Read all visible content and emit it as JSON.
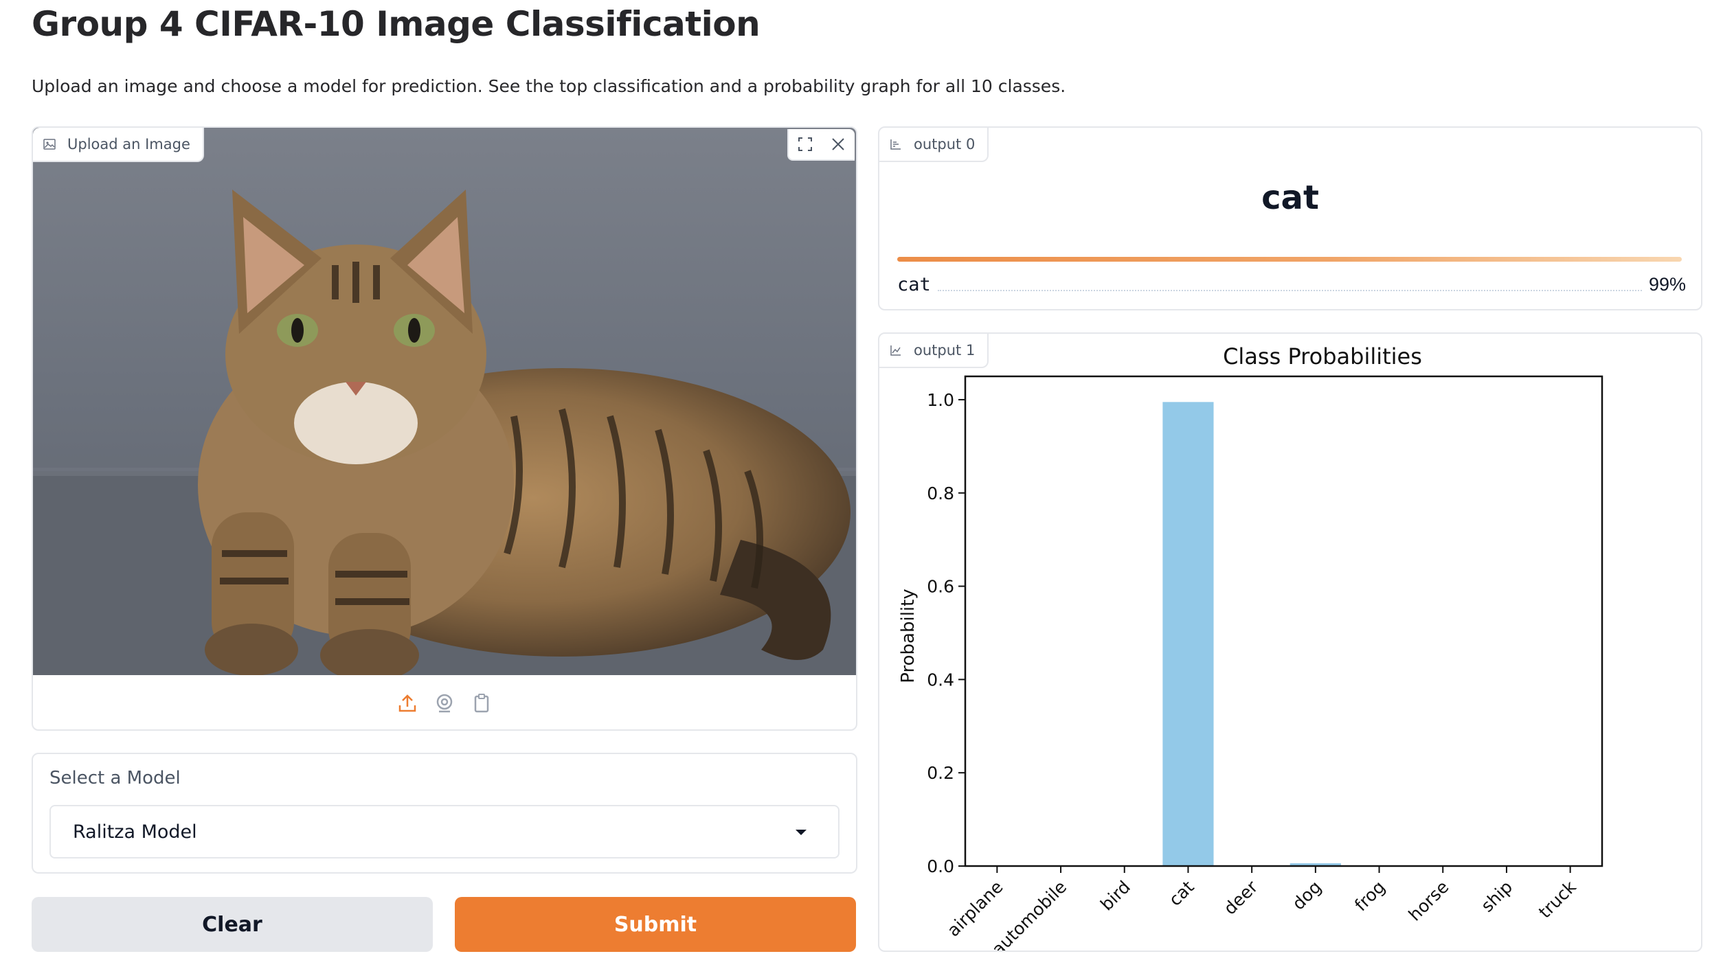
{
  "page": {
    "title": "Group 4 CIFAR-10 Image Classification",
    "description": "Upload an image and choose a model for prediction. See the top classification and a probability graph for all 10 classes."
  },
  "image_input": {
    "label": "Upload an Image"
  },
  "model_select": {
    "label": "Select a Model",
    "value": "Ralitza Model"
  },
  "buttons": {
    "clear": "Clear",
    "submit": "Submit"
  },
  "output0": {
    "label": "output 0",
    "top_class": "cat",
    "confidences": [
      {
        "label": "cat",
        "value": 0.99,
        "display": "99%"
      }
    ]
  },
  "output1": {
    "label": "output 1"
  },
  "colors": {
    "accent": "#ed7d31",
    "bar": "#93c9e8",
    "secondary_button": "#e5e7eb"
  },
  "icons": {
    "upload_label": "image-icon",
    "tools": [
      "fullscreen-icon",
      "close-icon"
    ],
    "sources": [
      "upload-icon",
      "webcam-icon",
      "clipboard-icon"
    ],
    "output0": "label-icon",
    "output1": "chart-icon"
  },
  "chart_data": {
    "type": "bar",
    "title": "Class Probabilities",
    "xlabel": "",
    "ylabel": "Probability",
    "categories": [
      "airplane",
      "automobile",
      "bird",
      "cat",
      "deer",
      "dog",
      "frog",
      "horse",
      "ship",
      "truck"
    ],
    "values": [
      0.0,
      0.0,
      0.0,
      0.995,
      0.0,
      0.006,
      0.0,
      0.0,
      0.0,
      0.0
    ],
    "yticks": [
      "0.0",
      "0.2",
      "0.4",
      "0.6",
      "0.8",
      "1.0"
    ],
    "ylim": [
      0,
      1.05
    ],
    "grid": false,
    "legend": false
  }
}
